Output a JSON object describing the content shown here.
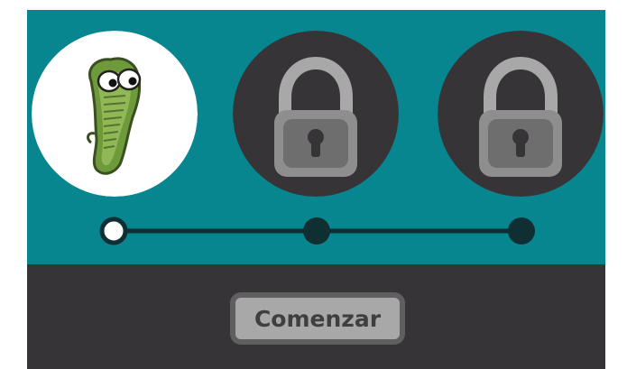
{
  "colors": {
    "background": "#08868f",
    "bottom_panel": "#363436",
    "locked_circle": "#363436",
    "unlocked_circle": "#ffffff",
    "track": "#0f2f33",
    "button_fill": "#a8a8a8",
    "button_text": "#3f3f3f"
  },
  "levels": [
    {
      "state": "unlocked",
      "icon": "germ-character-icon"
    },
    {
      "state": "locked",
      "icon": "padlock-icon"
    },
    {
      "state": "locked",
      "icon": "padlock-icon"
    }
  ],
  "progress": {
    "current_step": 1,
    "total_steps": 3
  },
  "start_button": {
    "label": "Comenzar"
  }
}
